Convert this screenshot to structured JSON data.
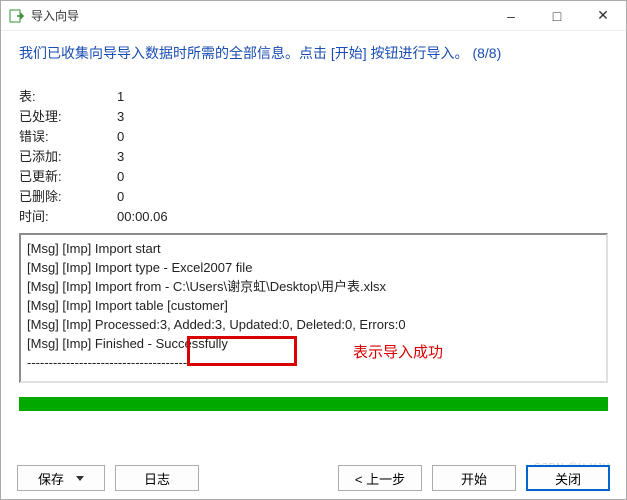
{
  "window": {
    "title": "导入向导"
  },
  "headline": "我们已收集向导导入数据时所需的全部信息。点击 [开始] 按钮进行导入。 (8/8)",
  "stats": {
    "tables_label": "表:",
    "tables_value": "1",
    "processed_label": "已处理:",
    "processed_value": "3",
    "errors_label": "错误:",
    "errors_value": "0",
    "added_label": "已添加:",
    "added_value": "3",
    "updated_label": "已更新:",
    "updated_value": "0",
    "deleted_label": "已删除:",
    "deleted_value": "0",
    "time_label": "时间:",
    "time_value": "00:00.06"
  },
  "log": {
    "l0": "[Msg] [Imp] Import start",
    "l1": "[Msg] [Imp] Import type - Excel2007 file",
    "l2": "[Msg] [Imp] Import from - C:\\Users\\谢京虹\\Desktop\\用户表.xlsx",
    "l3": "[Msg] [Imp] Import table [customer]",
    "l4": "[Msg] [Imp] Processed:3, Added:3, Updated:0, Deleted:0, Errors:0",
    "l5": "[Msg] [Imp] Finished - Successfully",
    "l6": "--------------------------------------------------"
  },
  "annotation": "表示导入成功",
  "buttons": {
    "save": "保存",
    "log": "日志",
    "back": "< 上一步",
    "start": "开始",
    "close": "关闭"
  },
  "watermark": "CSDN @H-YJH"
}
